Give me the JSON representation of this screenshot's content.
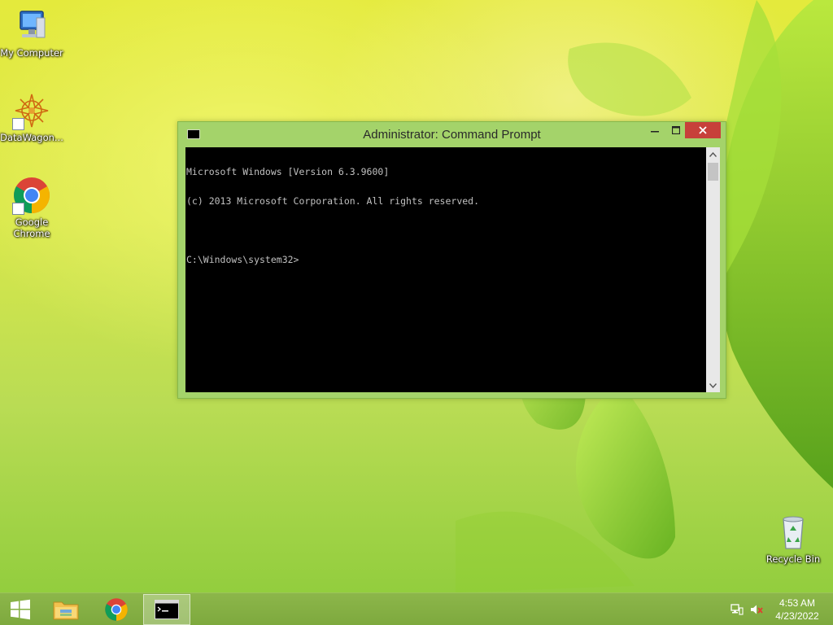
{
  "desktop": {
    "icons": [
      {
        "name": "my-computer",
        "label": "My Computer"
      },
      {
        "name": "datawagon",
        "label": "DataWagon..."
      },
      {
        "name": "google-chrome",
        "label": "Google Chrome"
      },
      {
        "name": "recycle-bin",
        "label": "Recycle Bin"
      }
    ]
  },
  "window": {
    "title": "Administrator: Command Prompt",
    "title_icon": "cmd-icon",
    "controls": {
      "minimize_icon": "minimize-icon",
      "maximize_icon": "maximize-icon",
      "close_icon": "close-icon"
    },
    "console_lines": [
      "Microsoft Windows [Version 6.3.9600]",
      "(c) 2013 Microsoft Corporation. All rights reserved.",
      "",
      "C:\\Windows\\system32>"
    ]
  },
  "taskbar": {
    "items": [
      {
        "name": "start",
        "icon": "windows-logo-icon"
      },
      {
        "name": "file-explorer",
        "icon": "folder-icon"
      },
      {
        "name": "chrome",
        "icon": "chrome-icon"
      },
      {
        "name": "command-prompt",
        "icon": "cmd-icon",
        "active": true
      }
    ],
    "tray": {
      "network_icon": "network-icon",
      "volume_icon": "volume-muted-icon"
    },
    "clock": {
      "time": "4:53 AM",
      "date": "4/23/2022"
    }
  },
  "colors": {
    "taskbar": "#7ea93e",
    "window_frame": "#a4d36a",
    "close_button": "#c7403a",
    "console_background": "#000000",
    "console_text": "#c0c0c0"
  }
}
